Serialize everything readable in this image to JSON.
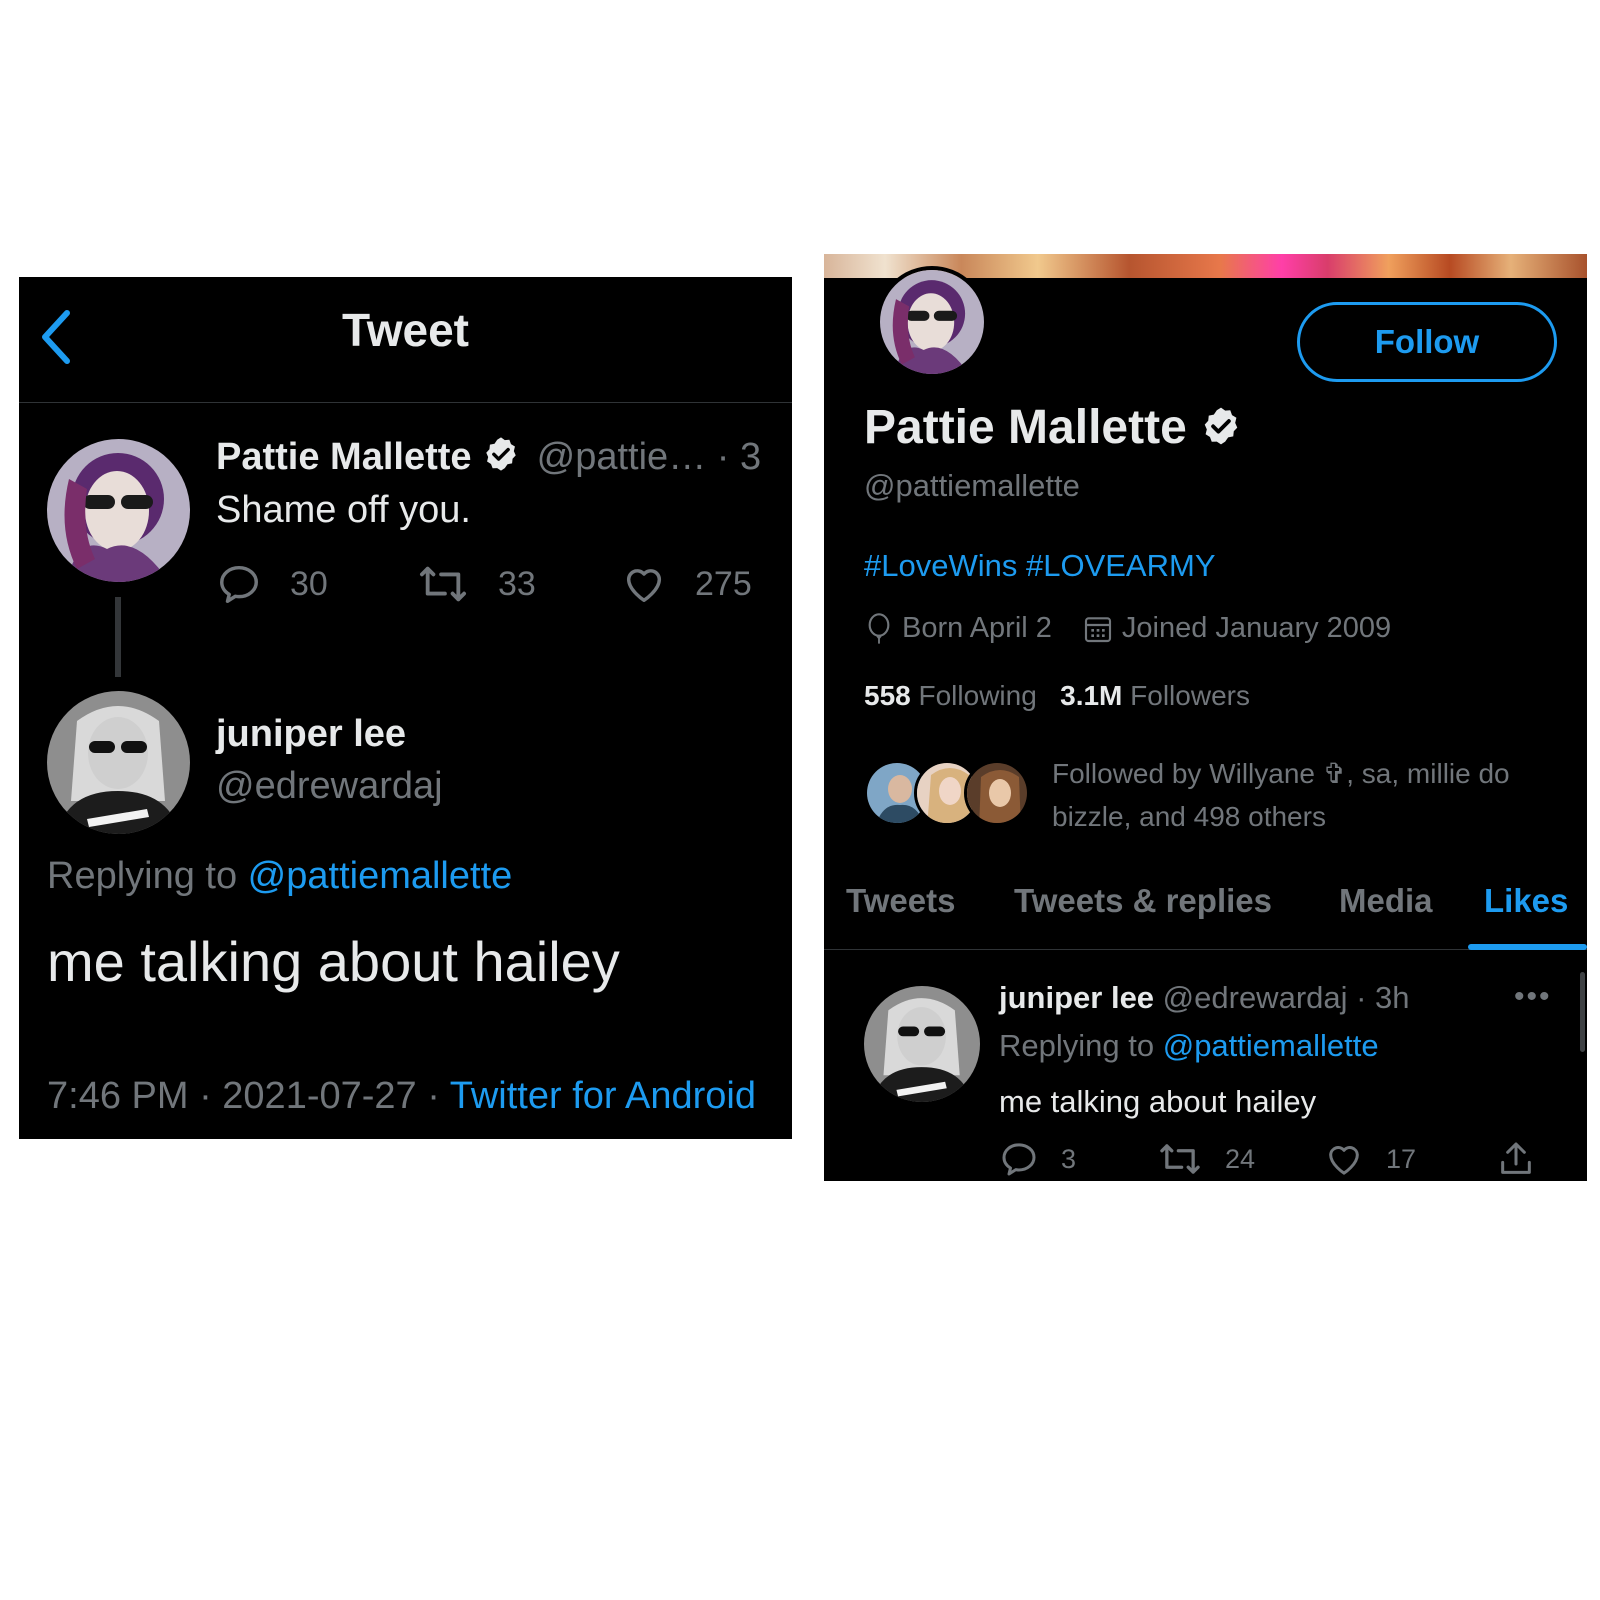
{
  "left": {
    "header": {
      "title": "Tweet"
    },
    "tweet1": {
      "name": "Pattie Mallette",
      "handle": "@pattie… · 3",
      "text": "Shame off you.",
      "replies": "30",
      "retweets": "33",
      "likes": "275"
    },
    "tweet2": {
      "name": "juniper lee",
      "handle": "@edrewardaj",
      "replying_prefix": "Replying to ",
      "replying_handle": "@pattiemallette",
      "text": "me talking about hailey",
      "time": "7:46 PM · 2021-07-27 · ",
      "source": "Twitter for Android"
    }
  },
  "right": {
    "follow_label": "Follow",
    "name": "Pattie Mallette",
    "handle": "@pattiemallette",
    "bio": {
      "tag1": "#LoveWins",
      "tag2": "#LOVEARMY"
    },
    "born": "Born April 2",
    "joined": "Joined January 2009",
    "stats": {
      "following_count": "558",
      "following_label": "Following",
      "followers_count": "3.1M",
      "followers_label": "Followers"
    },
    "followed_by": "Followed by Willyane ✞, sa, millie do bizzle, and 498 others",
    "tabs": [
      "Tweets",
      "Tweets & replies",
      "Media",
      "Likes"
    ],
    "liked_tweet": {
      "name": "juniper lee",
      "handle_time": "@edrewardaj · 3h",
      "more": "•••",
      "replying_prefix": "Replying to ",
      "replying_handle": "@pattiemallette",
      "text": "me talking about hailey",
      "replies": "3",
      "retweets": "24",
      "likes": "17"
    }
  },
  "colors": {
    "background": "#000000",
    "accent": "#1d9bf0",
    "muted": "#71767b",
    "text": "#e7e9ea"
  }
}
